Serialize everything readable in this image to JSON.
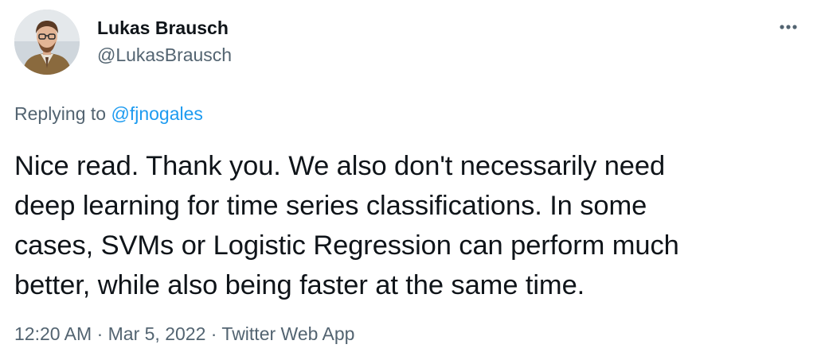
{
  "author": {
    "display_name": "Lukas Brausch",
    "handle": "@LukasBrausch"
  },
  "reply": {
    "prefix": "Replying to ",
    "mention": "@fjnogales"
  },
  "tweet": {
    "lines": [
      "Nice read. Thank you. We also don't necessarily need",
      "deep learning for time series classifications. In some",
      "cases, SVMs or Logistic Regression can perform much",
      "better, while also being faster at the same time."
    ]
  },
  "meta": {
    "time": "12:20 AM",
    "separator": " · ",
    "date": "Mar 5, 2022",
    "source": "Twitter Web App"
  },
  "icons": {
    "more": "more-horizontal-icon",
    "avatar": "profile-photo"
  },
  "colors": {
    "primary_text": "#0f1419",
    "secondary_text": "#536471",
    "accent": "#1d9bf0",
    "background": "#ffffff"
  }
}
